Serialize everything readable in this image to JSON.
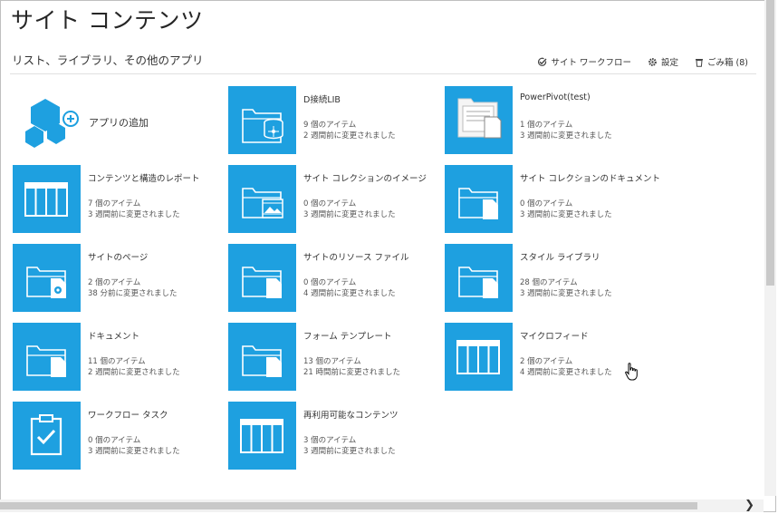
{
  "header": {
    "title": "サイト コンテンツ",
    "section": "リスト、ライブラリ、その他のアプリ"
  },
  "toolbar": {
    "workflow": "サイト ワークフロー",
    "settings": "設定",
    "recycle": "ごみ箱 (8)"
  },
  "add_app": {
    "label": "アプリの追加"
  },
  "tiles": [
    {
      "name": "D接続LIB",
      "count": "9 個のアイテム",
      "modified": "2 週間前に変更されました",
      "icon": "database-library"
    },
    {
      "name": "PowerPivot(test)",
      "count": "1 個のアイテム",
      "modified": "3 週間前に変更されました",
      "icon": "powerpivot-library"
    },
    {
      "name": "コンテンツと構造のレポート",
      "count": "7 個のアイテム",
      "modified": "3 週間前に変更されました",
      "icon": "list"
    },
    {
      "name": "サイト コレクションのイメージ",
      "count": "0 個のアイテム",
      "modified": "3 週間前に変更されました",
      "icon": "image-library"
    },
    {
      "name": "サイト コレクションのドキュメント",
      "count": "0 個のアイテム",
      "modified": "3 週間前に変更されました",
      "icon": "document-library"
    },
    {
      "name": "サイトのページ",
      "count": "2 個のアイテム",
      "modified": "38 分前に変更されました",
      "icon": "wiki-library"
    },
    {
      "name": "サイトのリソース ファイル",
      "count": "0 個のアイテム",
      "modified": "4 週間前に変更されました",
      "icon": "document-library"
    },
    {
      "name": "スタイル ライブラリ",
      "count": "28 個のアイテム",
      "modified": "3 週間前に変更されました",
      "icon": "document-library"
    },
    {
      "name": "ドキュメント",
      "count": "11 個のアイテム",
      "modified": "2 週間前に変更されました",
      "icon": "document-library"
    },
    {
      "name": "フォーム テンプレート",
      "count": "13 個のアイテム",
      "modified": "21 時間前に変更されました",
      "icon": "document-library"
    },
    {
      "name": "マイクロフィード",
      "count": "2 個のアイテム",
      "modified": "4 週間前に変更されました",
      "icon": "list"
    },
    {
      "name": "ワークフロー タスク",
      "count": "0 個のアイテム",
      "modified": "3 週間前に変更されました",
      "icon": "task-list"
    },
    {
      "name": "再利用可能なコンテンツ",
      "count": "3 個のアイテム",
      "modified": "3 週間前に変更されました",
      "icon": "list"
    }
  ],
  "colors": {
    "tile": "#1ea0e0",
    "icon_stroke": "#ffffff"
  }
}
